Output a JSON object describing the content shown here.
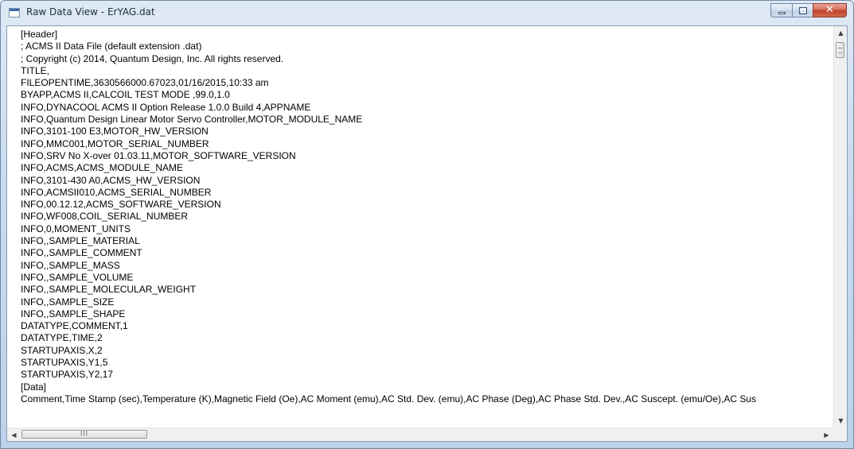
{
  "window": {
    "title": "Raw Data View - ErYAG.dat",
    "icon": "app-window-icon",
    "controls": {
      "minimize_icon": "minimize-icon",
      "maximize_icon": "maximize-icon",
      "close_icon": "close-icon",
      "close_glyph": "✕"
    }
  },
  "content": {
    "lines": [
      "[Header]",
      "; ACMS II Data File (default extension .dat)",
      "; Copyright (c) 2014, Quantum Design, Inc. All rights reserved.",
      "TITLE,",
      "FILEOPENTIME,3630566000.67023,01/16/2015,10:33 am",
      "BYAPP,ACMS II,CALCOIL TEST MODE ,99.0,1.0",
      "INFO,DYNACOOL ACMS II Option Release 1.0.0 Build 4,APPNAME",
      "INFO,Quantum Design Linear Motor Servo Controller,MOTOR_MODULE_NAME",
      "INFO,3101-100 E3,MOTOR_HW_VERSION",
      "INFO,MMC001,MOTOR_SERIAL_NUMBER",
      "INFO,SRV No X-over 01.03.11,MOTOR_SOFTWARE_VERSION",
      "INFO,ACMS,ACMS_MODULE_NAME",
      "INFO,3101-430 A0,ACMS_HW_VERSION",
      "INFO,ACMSII010,ACMS_SERIAL_NUMBER",
      "INFO,00.12.12,ACMS_SOFTWARE_VERSION",
      "INFO,WF008,COIL_SERIAL_NUMBER",
      "INFO,0,MOMENT_UNITS",
      "INFO,,SAMPLE_MATERIAL",
      "INFO,,SAMPLE_COMMENT",
      "INFO,,SAMPLE_MASS",
      "INFO,,SAMPLE_VOLUME",
      "INFO,,SAMPLE_MOLECULAR_WEIGHT",
      "INFO,,SAMPLE_SIZE",
      "INFO,,SAMPLE_SHAPE",
      "DATATYPE,COMMENT,1",
      "DATATYPE,TIME,2",
      "STARTUPAXIS,X,2",
      "STARTUPAXIS,Y1,5",
      "STARTUPAXIS,Y2,17",
      "[Data]",
      "Comment,Time Stamp (sec),Temperature (K),Magnetic Field (Oe),AC Moment (emu),AC Std. Dev. (emu),AC Phase (Deg),AC Phase Std. Dev.,AC Suscept. (emu/Oe),AC Sus"
    ]
  },
  "scrollbars": {
    "vertical": {
      "up_arrow": "▲",
      "down_arrow": "▼",
      "position": 0.03
    },
    "horizontal": {
      "left_arrow": "◀",
      "right_arrow": "▶",
      "grip": "III",
      "position": 0.0
    }
  }
}
